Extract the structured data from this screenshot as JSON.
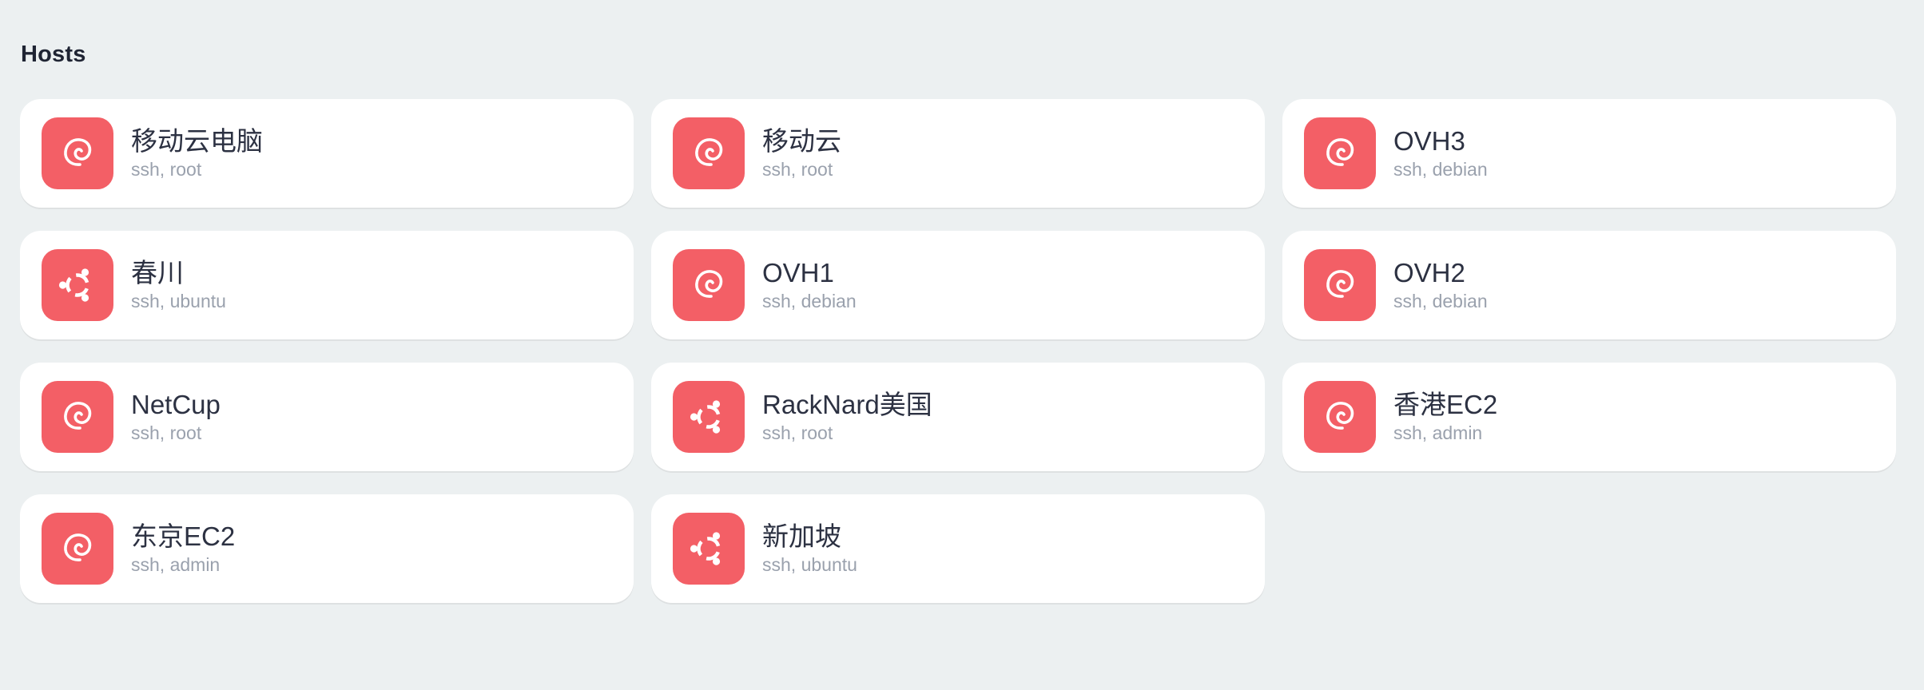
{
  "section": {
    "title": "Hosts"
  },
  "hosts": [
    {
      "name": "移动云电脑",
      "details": "ssh, root",
      "os_icon": "debian-icon"
    },
    {
      "name": "移动云",
      "details": "ssh, root",
      "os_icon": "debian-icon"
    },
    {
      "name": "OVH3",
      "details": "ssh, debian",
      "os_icon": "debian-icon"
    },
    {
      "name": "春川",
      "details": "ssh, ubuntu",
      "os_icon": "ubuntu-icon"
    },
    {
      "name": "OVH1",
      "details": "ssh, debian",
      "os_icon": "debian-icon"
    },
    {
      "name": "OVH2",
      "details": "ssh, debian",
      "os_icon": "debian-icon"
    },
    {
      "name": "NetCup",
      "details": "ssh, root",
      "os_icon": "debian-icon"
    },
    {
      "name": "RackNard美国",
      "details": "ssh, root",
      "os_icon": "ubuntu-icon"
    },
    {
      "name": "香港EC2",
      "details": "ssh, admin",
      "os_icon": "debian-icon"
    },
    {
      "name": "东京EC2",
      "details": "ssh, admin",
      "os_icon": "debian-icon"
    },
    {
      "name": "新加坡",
      "details": "ssh, ubuntu",
      "os_icon": "ubuntu-icon"
    }
  ],
  "colors": {
    "background": "#ecf0f1",
    "card": "#ffffff",
    "icon_tile": "#f35f66",
    "name_text": "#2c3142",
    "detail_text": "#9aa1ad"
  }
}
